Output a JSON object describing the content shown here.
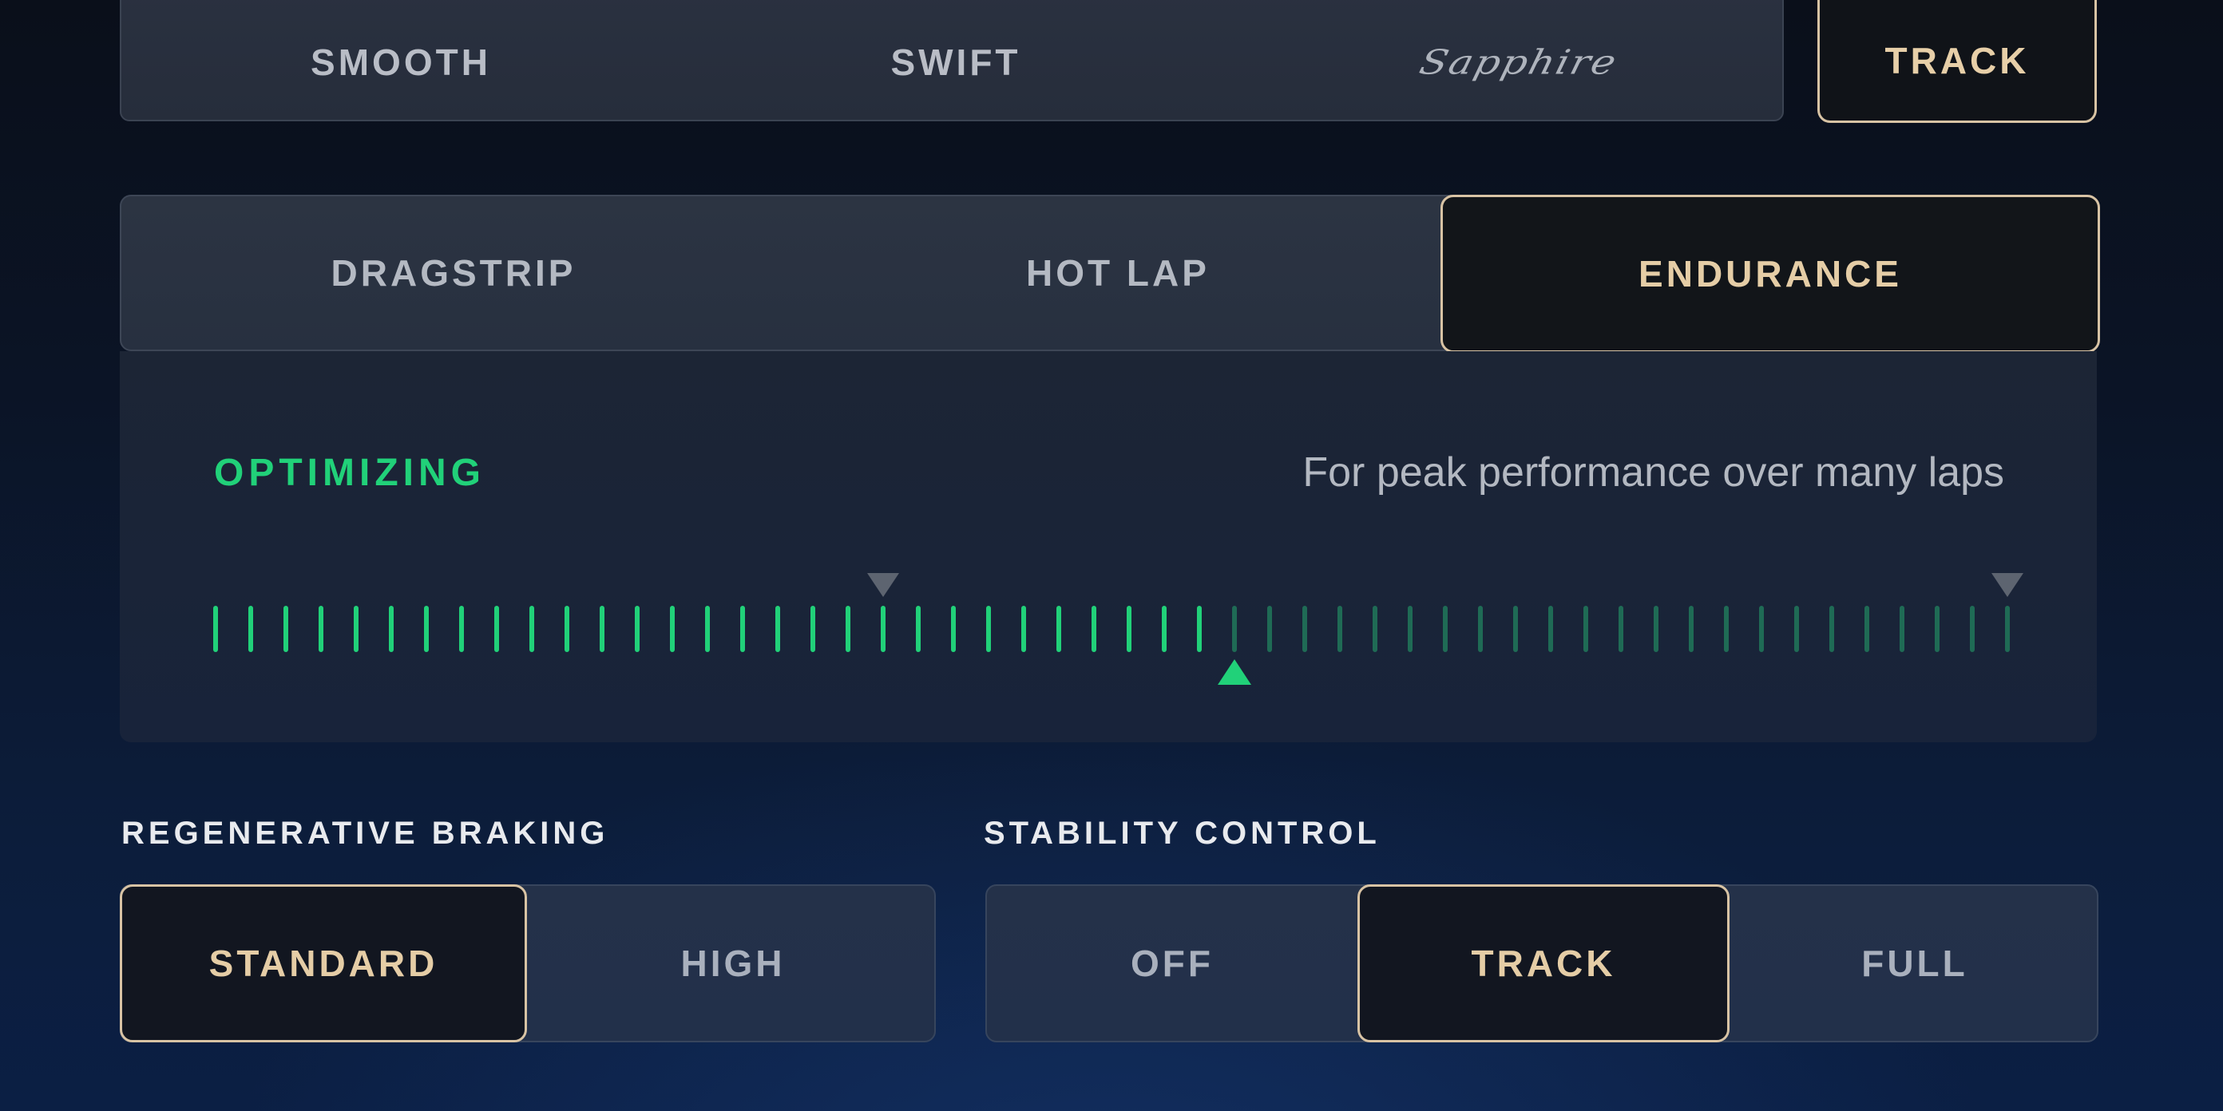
{
  "drive_modes": {
    "items": [
      {
        "label": "SMOOTH"
      },
      {
        "label": "SWIFT"
      },
      {
        "label": "Sapphire"
      }
    ],
    "track_label": "TRACK",
    "selected": "TRACK"
  },
  "program_tabs": {
    "items": [
      {
        "label": "DRAGSTRIP"
      },
      {
        "label": "HOT LAP"
      },
      {
        "label": "ENDURANCE"
      }
    ],
    "selected": "ENDURANCE"
  },
  "status": {
    "label": "OPTIMIZING",
    "description": "For peak performance over many laps"
  },
  "gauge": {
    "total_ticks": 52,
    "active_ticks": 29,
    "indicator_tick": 29,
    "markers": [
      19,
      51
    ],
    "active_color": "#21d179",
    "inactive_color": "#1f6b55",
    "marker_color": "#5d6470"
  },
  "regenerative_braking": {
    "title": "REGENERATIVE BRAKING",
    "options": [
      {
        "label": "STANDARD"
      },
      {
        "label": "HIGH"
      }
    ],
    "selected": "STANDARD"
  },
  "stability_control": {
    "title": "STABILITY CONTROL",
    "options": [
      {
        "label": "OFF"
      },
      {
        "label": "TRACK"
      },
      {
        "label": "FULL"
      }
    ],
    "selected": "TRACK"
  },
  "colors": {
    "accent_gold": "#d8c3a4",
    "accent_green": "#21d179",
    "background": "#0b1426"
  }
}
